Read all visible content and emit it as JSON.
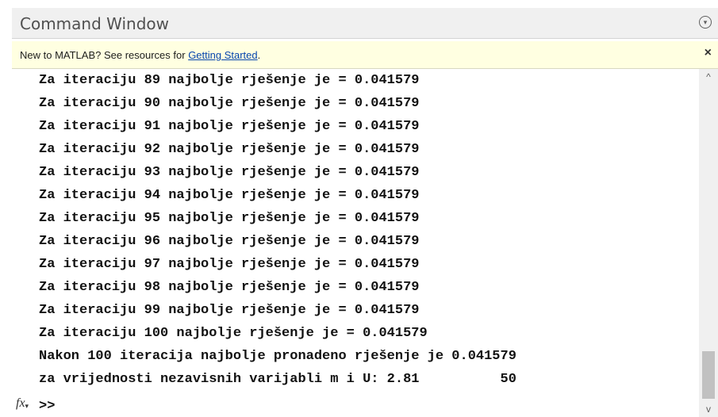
{
  "window": {
    "title": "Command Window",
    "menu_icon": "circle-chevron-down-icon"
  },
  "infobar": {
    "text_prefix": "New to MATLAB? See resources for ",
    "link_text": "Getting Started",
    "text_suffix": ".",
    "close_symbol": "×"
  },
  "console": {
    "lines": [
      "Za iteraciju 89 najbolje rješenje je = 0.041579",
      "Za iteraciju 90 najbolje rješenje je = 0.041579",
      "Za iteraciju 91 najbolje rješenje je = 0.041579",
      "Za iteraciju 92 najbolje rješenje je = 0.041579",
      "Za iteraciju 93 najbolje rješenje je = 0.041579",
      "Za iteraciju 94 najbolje rješenje je = 0.041579",
      "Za iteraciju 95 najbolje rješenje je = 0.041579",
      "Za iteraciju 96 najbolje rješenje je = 0.041579",
      "Za iteraciju 97 najbolje rješenje je = 0.041579",
      "Za iteraciju 98 najbolje rješenje je = 0.041579",
      "Za iteraciju 99 najbolje rješenje je = 0.041579",
      "Za iteraciju 100 najbolje rješenje je = 0.041579",
      "Nakon 100 iteracija najbolje pronadeno rješenje je 0.041579",
      "za vrijednosti nezavisnih varijabli m i U: 2.81          50"
    ],
    "fx_label": "fx",
    "prompt": ">>"
  },
  "scrollbar": {
    "up_symbol": "^",
    "down_symbol": "v"
  }
}
